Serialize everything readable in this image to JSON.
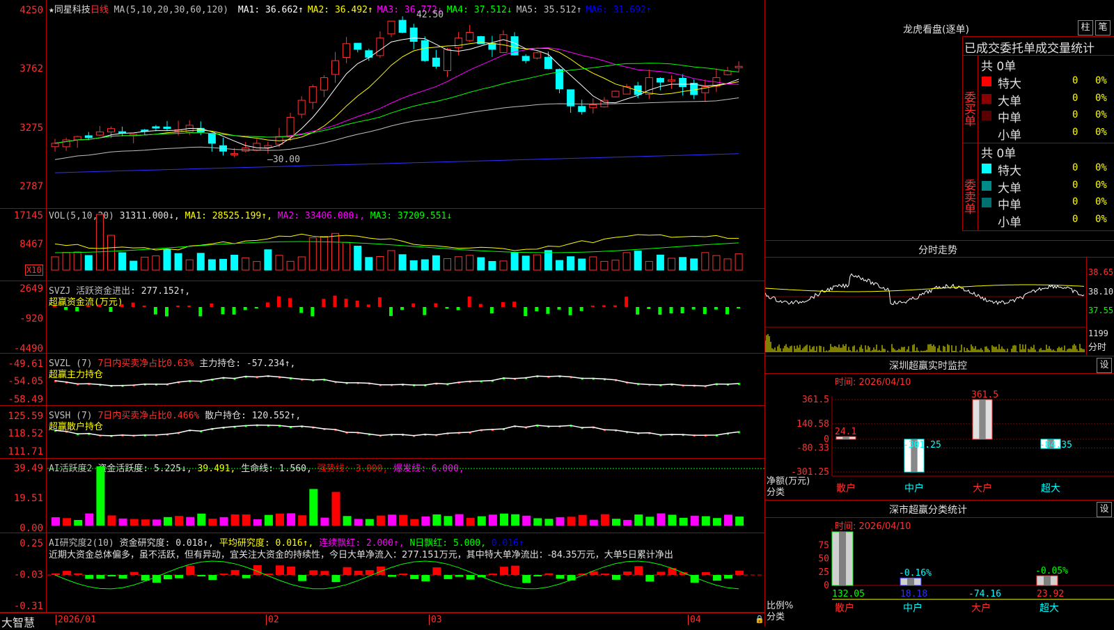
{
  "header": {
    "stock": "★同星科技",
    "period": "日线",
    "ma_def": "MA(5,10,20,30,60,120)",
    "ma": [
      {
        "label": "MA1:",
        "value": "36.662↑",
        "color": "#ffffff"
      },
      {
        "label": "MA2:",
        "value": "36.492↑",
        "color": "#ffff00"
      },
      {
        "label": "MA3:",
        "value": "36.772↓",
        "color": "#ff00ff"
      },
      {
        "label": "MA4:",
        "value": "37.512↓",
        "color": "#00ff00"
      },
      {
        "label": "MA5:",
        "value": "35.512↑",
        "color": "#c0c0c0"
      },
      {
        "label": "MA6:",
        "value": "31.692↑",
        "color": "#0000ff"
      }
    ]
  },
  "price_axis": [
    "4250",
    "3762",
    "3275",
    "2787"
  ],
  "price_annotations": {
    "high": "42.50",
    "low": "30.00"
  },
  "vol": {
    "title": "VOL(5,10,20)",
    "value": "31311.000↓,",
    "ma1": "MA1: 28525.199↑,",
    "ma2": "MA2: 33406.000↓,",
    "ma3": "MA3: 37209.551↓",
    "axis": [
      "17145",
      "8467"
    ],
    "unit": "X10"
  },
  "svzj": {
    "title": "SVZJ  活跃资金进出:",
    "value": "277.152↑,",
    "sub": "超赢资金流(万元)",
    "axis": [
      "2649",
      "-920",
      "-4490"
    ]
  },
  "svzl": {
    "title": "SVZL (7)",
    "p1": "7日内买卖净占比0.63%",
    "p2": "主力持仓: -57.234↑,",
    "sub": "超赢主力持仓",
    "axis": [
      "-49.61",
      "-54.05",
      "-58.49"
    ]
  },
  "svsh": {
    "title": "SVSH (7)",
    "p1": "7日内买卖净占比0.466%",
    "p2": "散户持仓: 120.552↑,",
    "sub": "超赢散户持仓",
    "axis": [
      "125.59",
      "118.52",
      "111.71"
    ]
  },
  "ai1": {
    "title": "AI活跃度2",
    "p1": "资金活跃度: 5.225↓,",
    "p2": "39.491,",
    "p3": "生命线: 1.560,",
    "p4": "强势线: 3.000,",
    "p5": "爆发线: 6.000,",
    "axis": [
      "39.49",
      "19.51",
      "0.00"
    ]
  },
  "ai2": {
    "title": "AI研究度2(10)",
    "p1": "资金研究度: 0.018↑,",
    "p2": "平均研究度: 0.016↑,",
    "p3": "连续飘红: 2.000↑,",
    "p4": "N日飘红: 5.000,",
    "p5": "0.016↑",
    "text": "近期大资金总体偏多，虽不活跃，但有异动，宜关注大资金的持续性，今日大单净流入：277.151万元，其中特大单净流出：-84.35万元，大单5日累计净出",
    "axis": [
      "0.25",
      "-0.03",
      "-0.31"
    ]
  },
  "footer": {
    "brand": "大智慧",
    "dates": [
      "2026/01",
      "02",
      "03",
      "04"
    ]
  },
  "right": {
    "lhb_title": "龙虎看盘(逐单)",
    "btn1": "柱",
    "btn2": "笔",
    "stats_title": "已成交委托单成交量统计",
    "buy_label": "委买单",
    "sell_label": "委卖单",
    "buy_total": "共 0单",
    "sell_total": "共 0单",
    "buy_rows": [
      {
        "name": "特大",
        "n": "0",
        "p": "0%",
        "color": "#ff0000"
      },
      {
        "name": "大单",
        "n": "0",
        "p": "0%",
        "color": "#8b0000"
      },
      {
        "name": "中单",
        "n": "0",
        "p": "0%",
        "color": "#5a0000"
      },
      {
        "name": "小单",
        "n": "0",
        "p": "0%",
        "color": "#000000"
      }
    ],
    "sell_rows": [
      {
        "name": "特大",
        "n": "0",
        "p": "0%",
        "color": "#00ffff"
      },
      {
        "name": "大单",
        "n": "0",
        "p": "0%",
        "color": "#008b8b"
      },
      {
        "name": "中单",
        "n": "0",
        "p": "0%",
        "color": "#007070"
      },
      {
        "name": "小单",
        "n": "0",
        "p": "0%",
        "color": "#000000"
      }
    ],
    "fs_title": "分时走势",
    "fs_axis": [
      "38.65",
      "38.10",
      "37.55"
    ],
    "fs_vol": "1199",
    "fs_label": "分时",
    "mon_title": "深圳超赢实时监控",
    "mon_btn": "设",
    "mon_time": "时间: 2026/04/10",
    "mon_axis": [
      "361.5",
      "140.58",
      "0",
      "-80.33",
      "-301.25"
    ],
    "mon_ylabel": "净额(万元)",
    "mon_xlabel": "分类",
    "mon_bars": [
      {
        "cat": "散户",
        "value": 24.1,
        "label": "24.1"
      },
      {
        "cat": "中户",
        "value": -301.25,
        "label": "-301.25"
      },
      {
        "cat": "大户",
        "value": 361.5,
        "label": "361.5"
      },
      {
        "cat": "超大",
        "value": -84.35,
        "label": "-84.35"
      }
    ],
    "cls_title": "深市超赢分类统计",
    "cls_btn": "设",
    "cls_time": "时间: 2026/04/10",
    "cls_axis": [
      "75",
      "50",
      "25",
      "0"
    ],
    "cls_ylabel": "比例%",
    "cls_xlabel": "分类",
    "cls_bars": [
      {
        "cat": "散户",
        "pct": 100,
        "val": "132.05",
        "label": ""
      },
      {
        "cat": "中户",
        "pct": 14,
        "val": "18.18",
        "label": "-0.16%"
      },
      {
        "cat": "大户",
        "pct": 0,
        "val": "-74.16",
        "label": ""
      },
      {
        "cat": "超大",
        "pct": 18,
        "val": "23.92",
        "label": "-0.05%"
      }
    ]
  }
}
